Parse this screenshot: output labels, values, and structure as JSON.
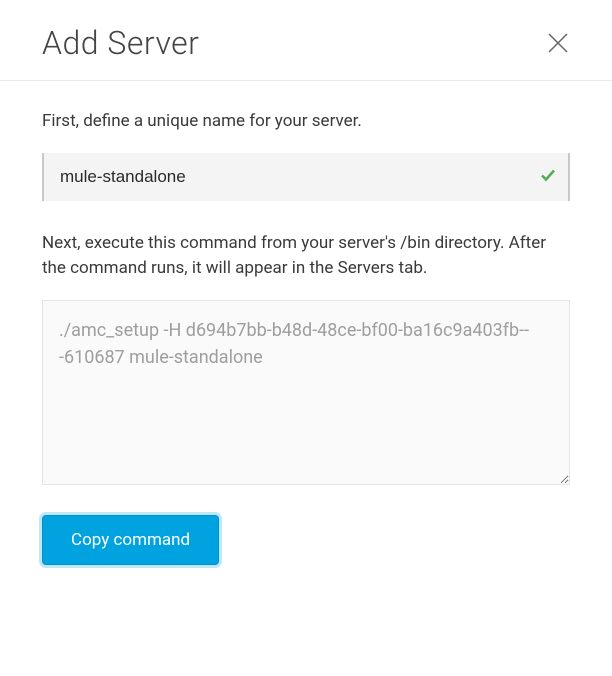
{
  "dialog": {
    "title": "Add Server",
    "instruction1": "First, define a unique name for your server.",
    "serverNameValue": "mule-standalone",
    "instruction2": "Next, execute this command from your server's /bin directory. After the command runs, it will appear in the Servers tab.",
    "commandText": "./amc_setup -H d694b7bb-b48d-48ce-bf00-ba16c9a403fb---610687 mule-standalone",
    "copyButtonLabel": "Copy command"
  }
}
